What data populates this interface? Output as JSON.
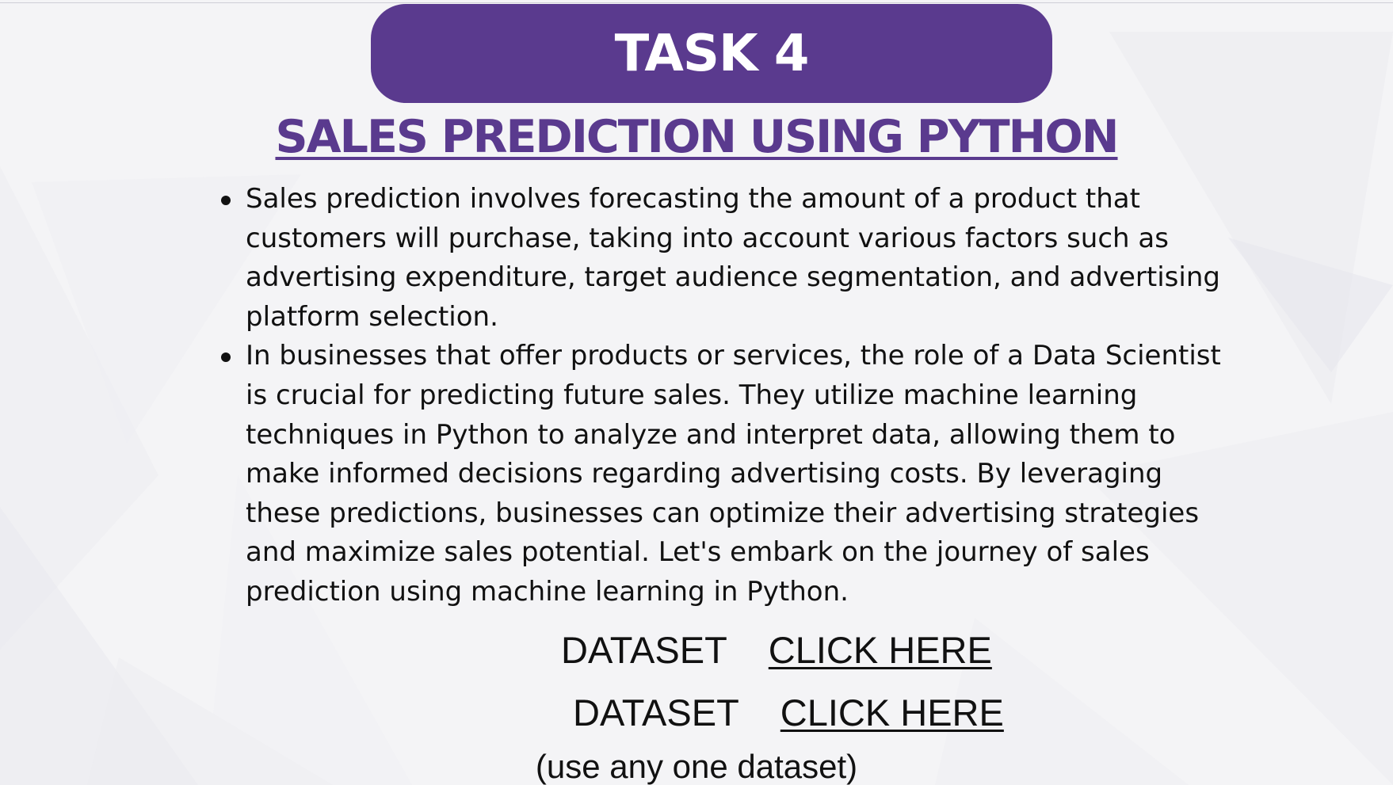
{
  "banner": {
    "title": "TASK 4"
  },
  "page_title": "SALES PREDICTION USING PYTHON",
  "bullets": [
    {
      "text": "Sales prediction involves forecasting the amount of a product that customers will purchase, taking into account various factors such as advertising expenditure, target audience segmentation, and advertising platform selection."
    },
    {
      "text": "In businesses that offer products or services, the role of a Data Scientist is crucial for predicting future sales. They utilize machine learning techniques in Python to analyze and interpret data, allowing them to make informed decisions regarding advertising costs. By leveraging these predictions, businesses can optimize their advertising strategies and maximize sales potential. Let's embark on the journey of sales prediction using machine learning in Python."
    }
  ],
  "datasets": [
    {
      "label": "DATASET",
      "link_text": "CLICK HERE"
    },
    {
      "label": "DATASET",
      "link_text": "CLICK HERE"
    }
  ],
  "note": "(use any one dataset)",
  "colors": {
    "accent_purple": "#5a3a8e",
    "background": "#f4f4f6",
    "text": "#111111"
  }
}
